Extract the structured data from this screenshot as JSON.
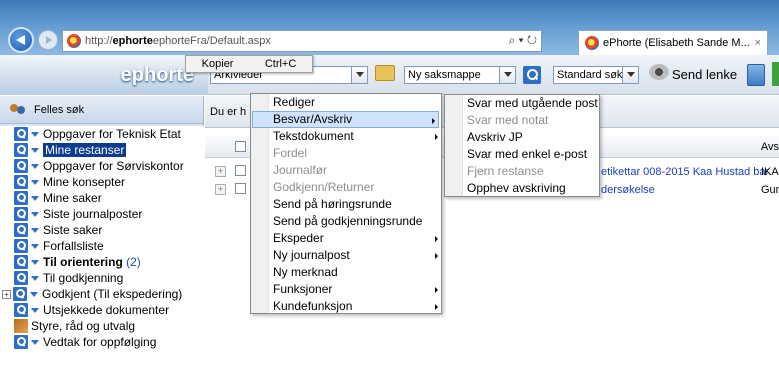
{
  "browser": {
    "url_prefix": "http://",
    "url_host": "ephorte",
    "url_path": "ephorteFra/Default.aspx",
    "addr_tools": "⌕ ▾ ↻",
    "tab_title": "ePhorte (Elisabeth Sande M...",
    "tab_close": "×"
  },
  "clip_menu": {
    "copy": "Kopier",
    "shortcut": "Ctrl+C"
  },
  "toolbar": {
    "brand": "ephorte",
    "role_select": "Arkivleder",
    "folder_select": "Ny saksmappe",
    "search_select": "Standard søk",
    "send_link": "Send lenke"
  },
  "sidebar": {
    "header": "Felles søk",
    "items": [
      {
        "label": "Oppgaver for Teknisk Etat"
      },
      {
        "label": "Mine restanser"
      },
      {
        "label": "Oppgaver for Sørviskontor"
      },
      {
        "label": "Mine konsepter"
      },
      {
        "label": "Mine saker"
      },
      {
        "label": "Siste journalposter"
      },
      {
        "label": "Siste saker"
      },
      {
        "label": "Forfallsliste"
      },
      {
        "label": "Til orientering",
        "count": "(2)"
      },
      {
        "label": "Til godkjenning"
      },
      {
        "label": "Godkjent (Til ekspedering)"
      },
      {
        "label": "Utsjekkede dokumenter"
      },
      {
        "label": "Styre, råd og utvalg"
      },
      {
        "label": "Vedtak for oppfølging"
      }
    ]
  },
  "main": {
    "header_text": "Du er h",
    "col_avs": "Avs",
    "rows": [
      {
        "link": "etikettar 008-2015 Kaa Hustad bar",
        "col": "IKA"
      },
      {
        "link": "dersøkelse",
        "col": "Gun"
      }
    ]
  },
  "context_menu": {
    "items": [
      {
        "label": "Rediger",
        "disabled": false
      },
      {
        "label": "Besvar/Avskriv",
        "disabled": false
      },
      {
        "label": "Tekstdokument",
        "disabled": false
      },
      {
        "label": "Fordel",
        "disabled": true
      },
      {
        "label": "Journalfør",
        "disabled": true
      },
      {
        "label": "Godkjenn/Returner",
        "disabled": true
      },
      {
        "label": "Send på høringsrunde",
        "disabled": false
      },
      {
        "label": "Send på godkjenningsrunde",
        "disabled": false
      },
      {
        "label": "Ekspeder",
        "disabled": false
      },
      {
        "label": "Ny journalpost",
        "disabled": false
      },
      {
        "label": "Ny merknad",
        "disabled": false
      },
      {
        "label": "Funksjoner",
        "disabled": false
      },
      {
        "label": "Kundefunksjon",
        "disabled": false
      }
    ]
  },
  "submenu": {
    "items": [
      {
        "label": "Svar med utgående post",
        "disabled": false
      },
      {
        "label": "Svar med notat",
        "disabled": true
      },
      {
        "label": "Avskriv JP",
        "disabled": false
      },
      {
        "label": "Svar med enkel e-post",
        "disabled": false
      },
      {
        "label": "Fjern restanse",
        "disabled": true
      },
      {
        "label": "Opphev avskriving",
        "disabled": false
      }
    ]
  }
}
